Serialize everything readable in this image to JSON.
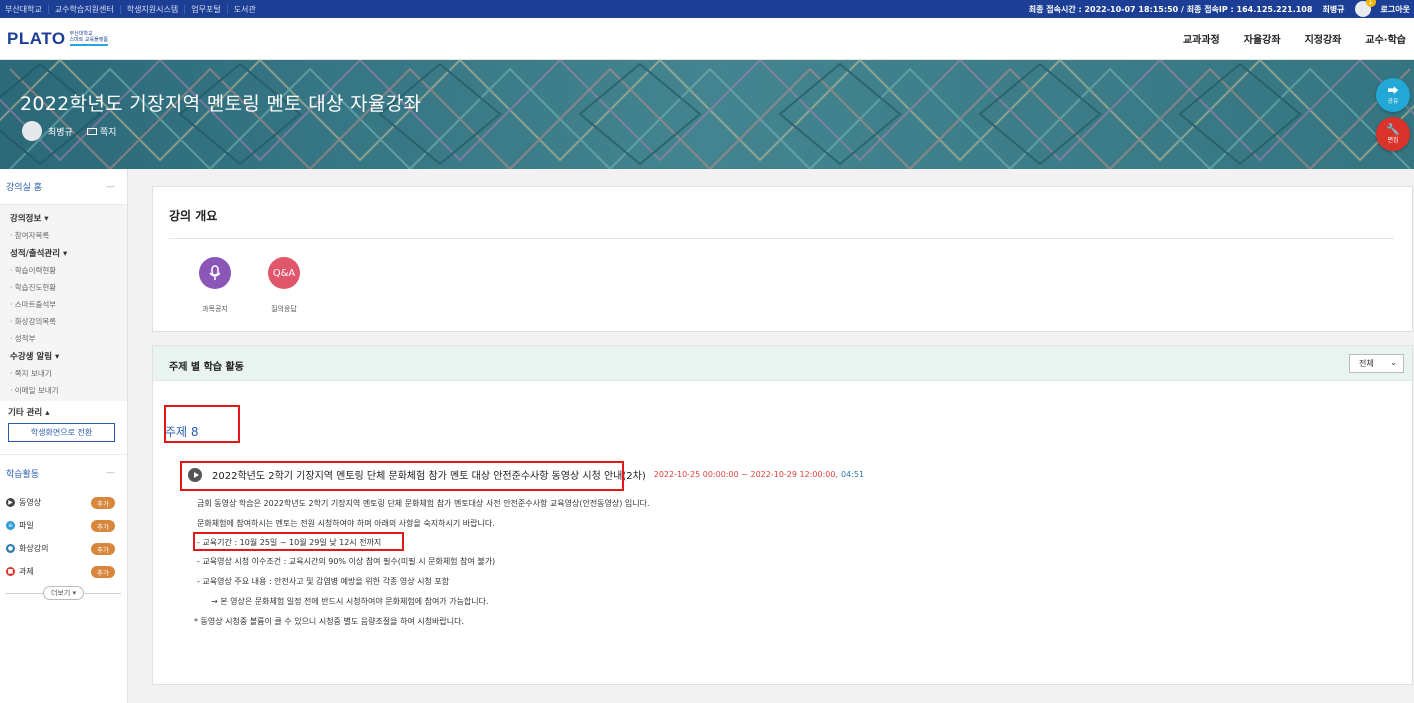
{
  "topbar": {
    "links": [
      "부산대학교",
      "교수학습지원센터",
      "학생지원시스템",
      "업무포털",
      "도서관"
    ],
    "last_access": "최종 접속시간 : 2022-10-07 18:15:50 / 최종 접속IP : 164.125.221.108",
    "user_name": "최병규",
    "notify_count": "1",
    "logout": "로그아웃"
  },
  "header": {
    "logo": "PLATO",
    "logo_sub_line1": "부산대학교",
    "logo_sub_line2": "스마트 교육플랫폼",
    "nav": [
      "교과과정",
      "자율강좌",
      "지정강좌",
      "교수·학습"
    ]
  },
  "banner": {
    "title": "2022학년도 기장지역 멘토링 멘토 대상 자율강좌",
    "user": "최병규",
    "mail": "쪽지",
    "share_label": "공유",
    "edit_label": "편집"
  },
  "sidebar": {
    "home": "강의실 홈",
    "sections": [
      {
        "title": "강의정보 ▾",
        "items": [
          "· 참여자목록"
        ]
      },
      {
        "title": "성적/출석관리 ▾",
        "items": [
          "· 학습이력현황",
          "· 학습진도현황",
          "· 스마트출석부",
          "· 화상강의목록",
          "· 성적부"
        ]
      },
      {
        "title": "수강생 알림 ▾",
        "items": [
          "· 쪽지 보내기",
          "· 이메일 보내기"
        ]
      }
    ],
    "etc": "기타 관리 ▴",
    "switch_button": "학생화면으로 전환",
    "activities_title": "학습활동",
    "activities": [
      {
        "label": "동영상",
        "color": "#444444",
        "glyph": "▶"
      },
      {
        "label": "파일",
        "color": "#2a9bd6",
        "glyph": "≡"
      },
      {
        "label": "화상강의",
        "color": "#2a7ab0",
        "glyph": "●"
      },
      {
        "label": "과제",
        "color": "#d9332b",
        "glyph": "■"
      }
    ],
    "add_label": "추가",
    "more": "더보기 ▾"
  },
  "overview": {
    "title": "강의 개요",
    "icons": [
      {
        "label": "과목공지",
        "color": "#8a56b8",
        "glyph": "🎙"
      },
      {
        "label": "질의응답",
        "color": "#e0566a",
        "glyph": "Q&A"
      }
    ]
  },
  "topics": {
    "title": "주제 별 학습 활동",
    "filter": "전체",
    "topic_name": "주제 8",
    "activity_title": "2022학년도 2학기 기장지역 멘토링 단체 문화체험 참가 멘토 대상 안전준수사항 동영상 시청 안내(2차)",
    "period": "2022-10-25 00:00:00 ~ 2022-10-29 12:00:00,",
    "duration": "04:51",
    "lines": [
      "금회 동영상 학습은 2022학년도 2학기 기장지역 멘토링  단체 문화체험 참가 멘토대상 사전 안전준수사항 교육영상(안전동영상) 입니다.",
      "문화체험에 참여하시는 멘토는 전원 시청하여야 하며 아래의 사항을 숙지하시기 바랍니다.",
      "- 교육기간 : 10월 25일 ~ 10월 29일 낮 12시 전까지",
      "- 교육영상 시청 이수조건 : 교육시간의 90% 이상 참여 필수(미필 시 문화체험 참여 불가)",
      "- 교육영상 주요 내용 : 안전사고 및 감염병 예방을 위한 각종 영상 시청 포함",
      "→  본 영상은 문화체험 일정 전에  반드시 시청하여야 문화체험에 참여가 가능합니다.",
      "* 동영상 시청중 볼륨이 클 수 있으니 시청중 별도 음량조절을 하여 시청바랍니다."
    ]
  },
  "colors": {
    "brand": "#1c3f95",
    "link": "#2a5db0",
    "highlight": "#e01818",
    "period": "#e04040"
  }
}
